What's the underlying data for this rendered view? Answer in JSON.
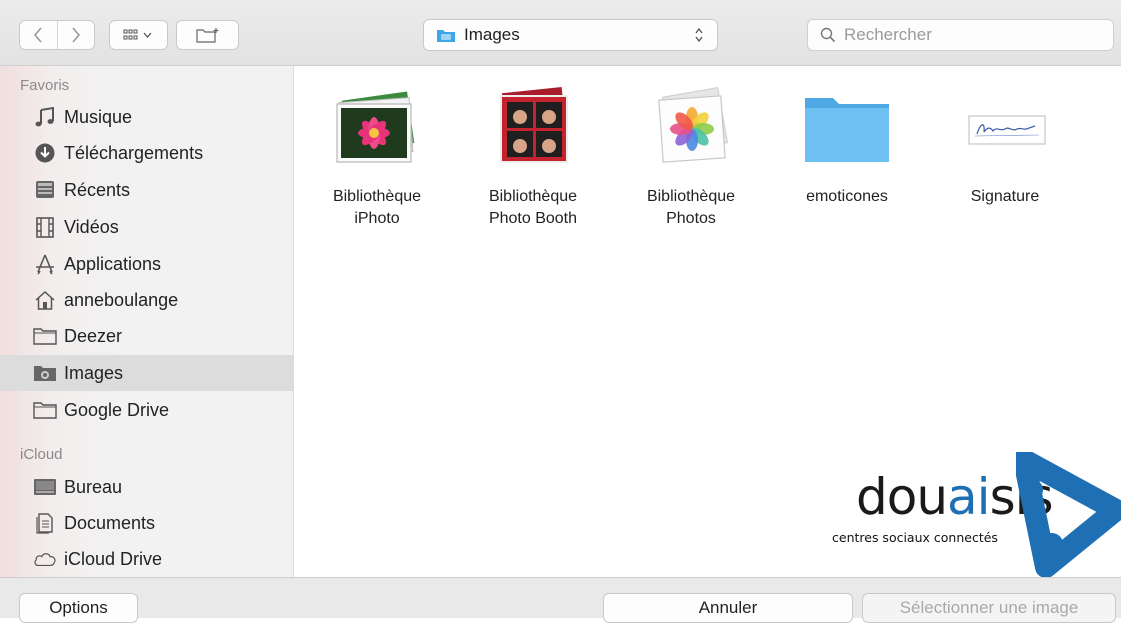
{
  "toolbar": {
    "back_icon": "chevron-left-icon",
    "forward_icon": "chevron-right-icon",
    "view_icon": "icon-grid-view-icon",
    "new_folder_icon": "new-folder-icon",
    "location": "Images",
    "search_placeholder": "Rechercher"
  },
  "sidebar": {
    "favorites_title": "Favoris",
    "favorites": [
      {
        "label": "Musique",
        "icon": "music-note-icon"
      },
      {
        "label": "Téléchargements",
        "icon": "download-icon"
      },
      {
        "label": "Récents",
        "icon": "recents-icon"
      },
      {
        "label": "Vidéos",
        "icon": "film-icon"
      },
      {
        "label": "Applications",
        "icon": "applications-icon"
      },
      {
        "label": "anneboulange",
        "icon": "home-icon"
      },
      {
        "label": "Deezer",
        "icon": "folder-icon"
      },
      {
        "label": "Images",
        "icon": "camera-folder-icon",
        "selected": true
      },
      {
        "label": "Google Drive",
        "icon": "folder-icon"
      }
    ],
    "icloud_title": "iCloud",
    "icloud": [
      {
        "label": "Bureau",
        "icon": "desktop-icon"
      },
      {
        "label": "Documents",
        "icon": "documents-icon"
      },
      {
        "label": "iCloud Drive",
        "icon": "cloud-icon"
      }
    ]
  },
  "files": [
    {
      "name": "Bibliothèque\niPhoto",
      "icon": "iphoto-library-icon"
    },
    {
      "name": "Bibliothèque\nPhoto Booth",
      "icon": "photo-booth-library-icon"
    },
    {
      "name": "Bibliothèque\nPhotos",
      "icon": "photos-library-icon"
    },
    {
      "name": "emoticones",
      "icon": "folder-icon"
    },
    {
      "name": "Signature",
      "icon": "signature-image-icon"
    }
  ],
  "buttons": {
    "options": "Options",
    "cancel": "Annuler",
    "select": "Sélectionner une image"
  },
  "watermark": {
    "word": "douaisis",
    "tagline": "centres sociaux connectés",
    "colors": {
      "blue": "#1f6fb4",
      "dark": "#1a1a1a"
    }
  },
  "colors": {
    "selection": "#dcdcdc",
    "folder_blue": "#5ab4ee",
    "disabled_text": "#a9a9a9"
  }
}
